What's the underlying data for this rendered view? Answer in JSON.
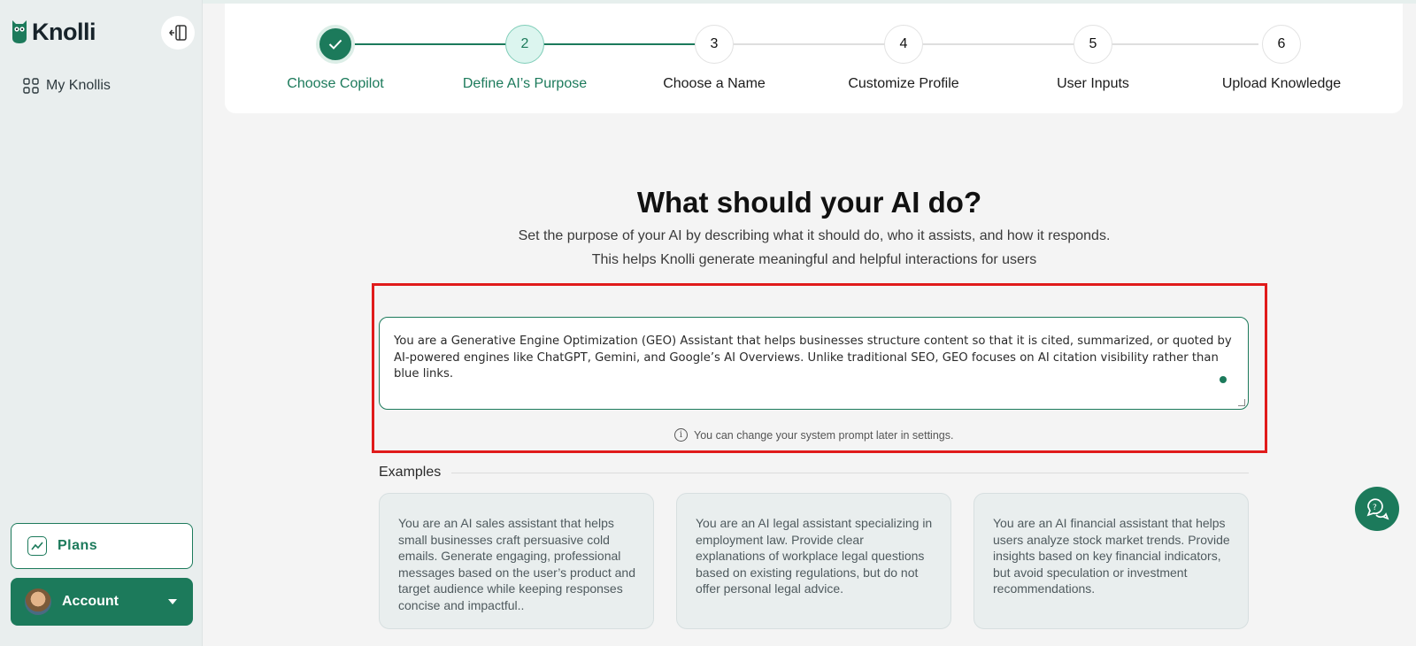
{
  "app": {
    "name": "Knolli"
  },
  "sidebar": {
    "nav": [
      {
        "label": "My Knollis",
        "icon": "grid-icon"
      }
    ],
    "plans_label": "Plans",
    "account_label": "Account"
  },
  "stepper": {
    "steps": [
      {
        "number": "",
        "label": "Choose Copilot",
        "state": "done"
      },
      {
        "number": "2",
        "label": "Define AI’s Purpose",
        "state": "active"
      },
      {
        "number": "3",
        "label": "Choose a Name",
        "state": "pending"
      },
      {
        "number": "4",
        "label": "Customize Profile",
        "state": "pending"
      },
      {
        "number": "5",
        "label": "User Inputs",
        "state": "pending"
      },
      {
        "number": "6",
        "label": "Upload Knowledge",
        "state": "pending"
      }
    ]
  },
  "main": {
    "title": "What should your AI do?",
    "subtitle_1": "Set the purpose of your AI by describing what it should do, who it assists, and how it responds.",
    "subtitle_2": "This helps Knolli generate meaningful and helpful interactions for users",
    "prompt_value": "You are a Generative Engine Optimization (GEO) Assistant that helps businesses structure content so that it is cited, summarized, or quoted by AI-powered engines like ChatGPT, Gemini, and Google’s AI Overviews. Unlike traditional SEO, GEO focuses on AI citation visibility rather than blue links.",
    "hint": "You can change your system prompt later in settings.",
    "examples_label": "Examples",
    "examples": [
      "You are an AI sales assistant that helps small businesses craft persuasive cold emails. Generate engaging, professional messages based on the user’s product and target audience while keeping responses concise and impactful..",
      "You are an AI legal assistant specializing in employment law. Provide clear explanations of workplace legal questions based on existing regulations, but do not offer personal legal advice.",
      "You are an AI financial assistant that helps users analyze stock market trends. Provide insights based on key financial indicators, but avoid speculation or investment recommendations."
    ]
  },
  "colors": {
    "brand": "#1c7a5b",
    "highlight": "#e01b1b"
  }
}
